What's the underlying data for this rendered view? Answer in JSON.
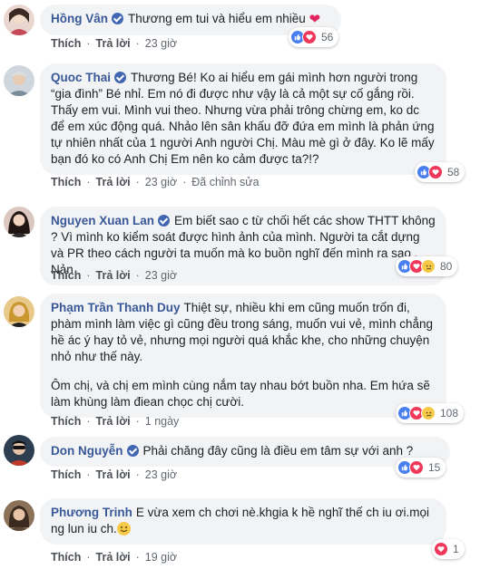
{
  "colors": {
    "name": "#385898",
    "bubble": "#f2f3f5",
    "like": "#4a7ff0",
    "love": "#f0385a",
    "yellow": "#f7c948"
  },
  "labels": {
    "like": "Thích",
    "reply": "Trả lời",
    "edited": "Đã chỉnh sửa"
  },
  "comments": [
    {
      "name": "Hồng Vân",
      "verified": true,
      "text": "Thương em tui và hiểu em nhiều",
      "time": "23 giờ",
      "reactions": [
        "like",
        "love"
      ],
      "count": "56"
    },
    {
      "name": "Quoc Thai",
      "verified": true,
      "text": "Thương Bé! Ko ai hiểu em gái mình hơn người trong “gia đình” Bé nhỉ. Em nó đi được như vậy là cả một sự cố gắng rồi. Thấy em vui. Mình vui theo. Nhưng vừa phải trông chừng em, ko dc để em xúc động quá. Nhảo lên sân khấu đỡ đứa em mình là phản ứng tự nhiên nhất của 1 người Anh người Chị. Màu mè gì ở đây. Ko lẽ mấy bạn đó ko có Anh Chị Em nên ko cảm được ta?!?",
      "time": "23 giờ",
      "edited": true,
      "reactions": [
        "like",
        "love"
      ],
      "count": "58"
    },
    {
      "name": "Nguyen Xuan Lan",
      "verified": true,
      "text": "Em biết sao c từ chối hết các show THTT không ? Vì mình ko kiểm soát được hình ảnh của mình. Người ta cắt dựng và PR theo cách người ta muốn mà ko buồn nghĩ đến mình ra sao . Nản",
      "time": "23 giờ",
      "reactions": [
        "like",
        "love",
        "sad"
      ],
      "count": "80"
    },
    {
      "name": "Phạm Trần Thanh Duy",
      "verified": false,
      "text": "Thiệt sự, nhiều khi em cũng muốn trốn đi, phàm mình làm việc gì cũng đều trong sáng, muốn vui vẻ, mình chẳng hề ác ý hay tỏ vẻ, nhưng mọi người quá khắc khe, cho những chuyện nhỏ như thế này.",
      "text2": "Ôm chị, và chị em mình cùng nắm tay nhau bớt buồn nha. Em hứa sẽ làm khùng làm điean chọc chị cười.",
      "time": "1 ngày",
      "reactions": [
        "like",
        "love",
        "sad"
      ],
      "count": "108"
    },
    {
      "name": "Don Nguyễn",
      "verified": true,
      "text": "Phải chăng đây cũng là điều em tâm sự với anh ?",
      "time": "23 giờ",
      "reactions": [
        "like",
        "love"
      ],
      "count": "15"
    },
    {
      "name": "Phương Trinh",
      "verified": false,
      "text": "E vừa xem ch chơi nè.khgia k hề nghĩ thế ch iu ơi.mọi ng lun iu ch.",
      "time": "19 giờ",
      "reactions": [
        "love"
      ],
      "count": "1"
    }
  ]
}
